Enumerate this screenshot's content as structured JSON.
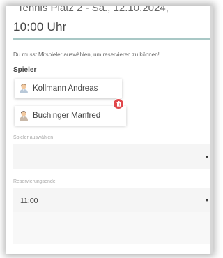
{
  "header": {
    "title_line1": "Tennis Platz 2 - Sa., 12.10.2024,",
    "title_line2": "10:00 Uhr"
  },
  "notice": "Du musst Mitspieler auswählen, um reservieren zu können!",
  "players_section": {
    "heading": "Spieler",
    "players": [
      {
        "name": "Kollmann Andreas",
        "avatar_icon": "person-avatar-icon"
      },
      {
        "name": "Buchinger Manfred",
        "avatar_icon": "person-avatar-icon"
      }
    ],
    "delete_icon": "trash-icon"
  },
  "player_select": {
    "label": "Spieler auswählen",
    "value": ""
  },
  "end_time": {
    "label": "Reservierungsende",
    "value": "11:00"
  },
  "colors": {
    "accent": "#a9c8c6",
    "delete_badge": "#e0464a",
    "field_background": "#f5f5f5"
  }
}
